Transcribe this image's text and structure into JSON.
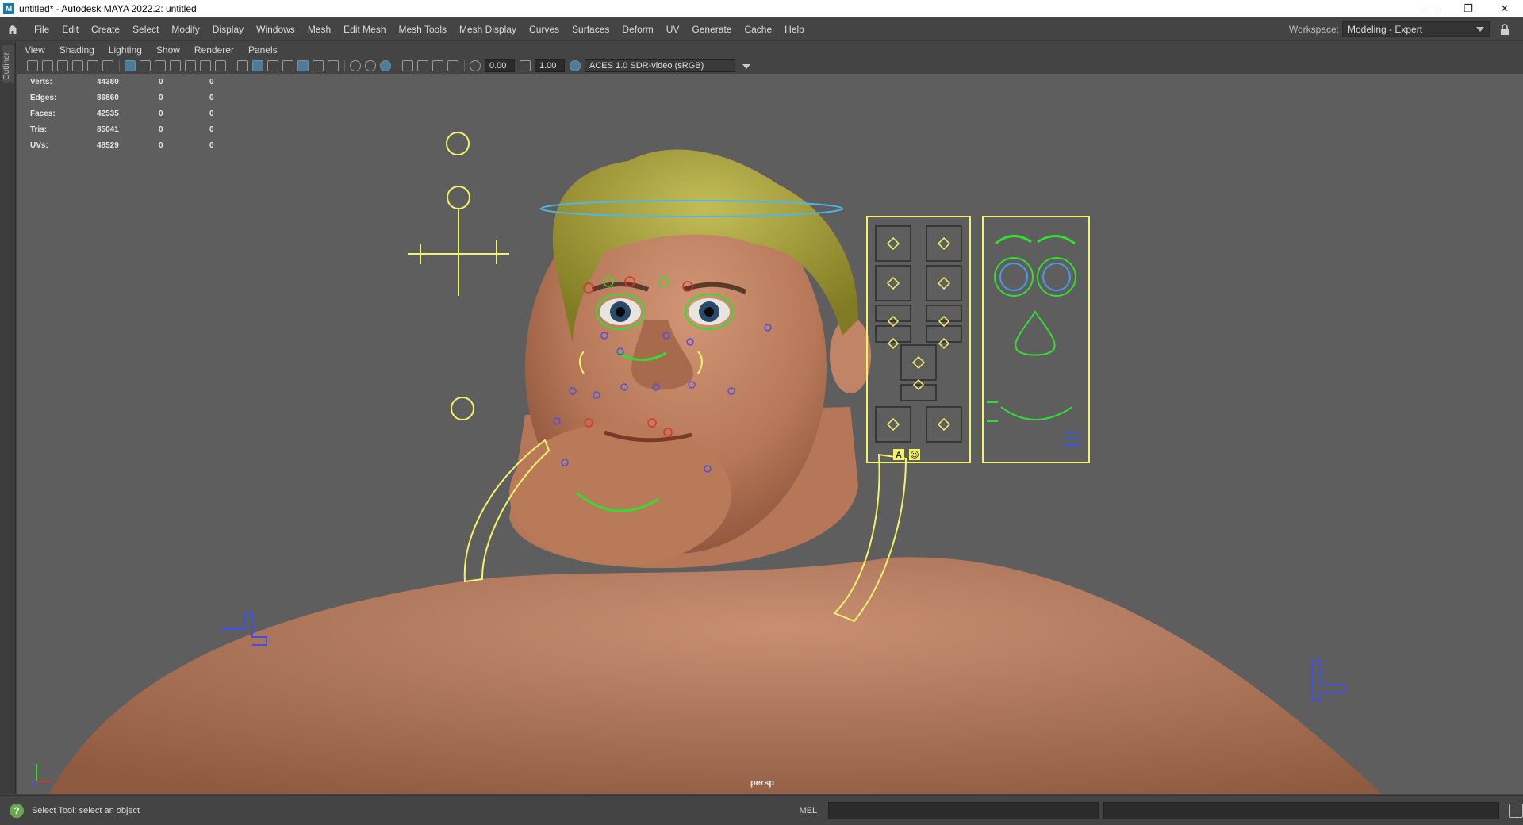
{
  "window": {
    "app_icon": "M",
    "title": "untitled* - Autodesk MAYA 2022.2: untitled",
    "minimize": "—",
    "restore": "❐",
    "close": "✕"
  },
  "main_menu": [
    "File",
    "Edit",
    "Create",
    "Select",
    "Modify",
    "Display",
    "Windows",
    "Mesh",
    "Edit Mesh",
    "Mesh Tools",
    "Mesh Display",
    "Curves",
    "Surfaces",
    "Deform",
    "UV",
    "Generate",
    "Cache",
    "Help"
  ],
  "workspace": {
    "label": "Workspace:",
    "value": "Modeling - Expert"
  },
  "outliner": {
    "label": "Outliner"
  },
  "panel_menu": [
    "View",
    "Shading",
    "Lighting",
    "Show",
    "Renderer",
    "Panels"
  ],
  "panel_toolbar": {
    "exposure": "0.00",
    "gamma": "1.00",
    "color_space": "ACES 1.0 SDR-video (sRGB)"
  },
  "hud": {
    "rows": [
      {
        "label": "Verts:",
        "v1": "44380",
        "v2": "0",
        "v3": "0"
      },
      {
        "label": "Edges:",
        "v1": "86860",
        "v2": "0",
        "v3": "0"
      },
      {
        "label": "Faces:",
        "v1": "42535",
        "v2": "0",
        "v3": "0"
      },
      {
        "label": "Tris:",
        "v1": "85041",
        "v2": "0",
        "v3": "0"
      },
      {
        "label": "UVs:",
        "v1": "48529",
        "v2": "0",
        "v3": "0"
      }
    ]
  },
  "viewport": {
    "camera": "persp",
    "background_color": "#5e5e5e",
    "skin_color": "#b87a5c",
    "hair_color": "#a9a23a",
    "control_yellow": "#f3f36a",
    "control_green": "#33dd33",
    "control_blue": "#4a9be0",
    "picker_buttons": {
      "a": "A",
      "b": "☺"
    }
  },
  "status": {
    "help_icon": "?",
    "help_text": "Select Tool: select an object",
    "mel_label": "MEL",
    "command_value": ""
  }
}
